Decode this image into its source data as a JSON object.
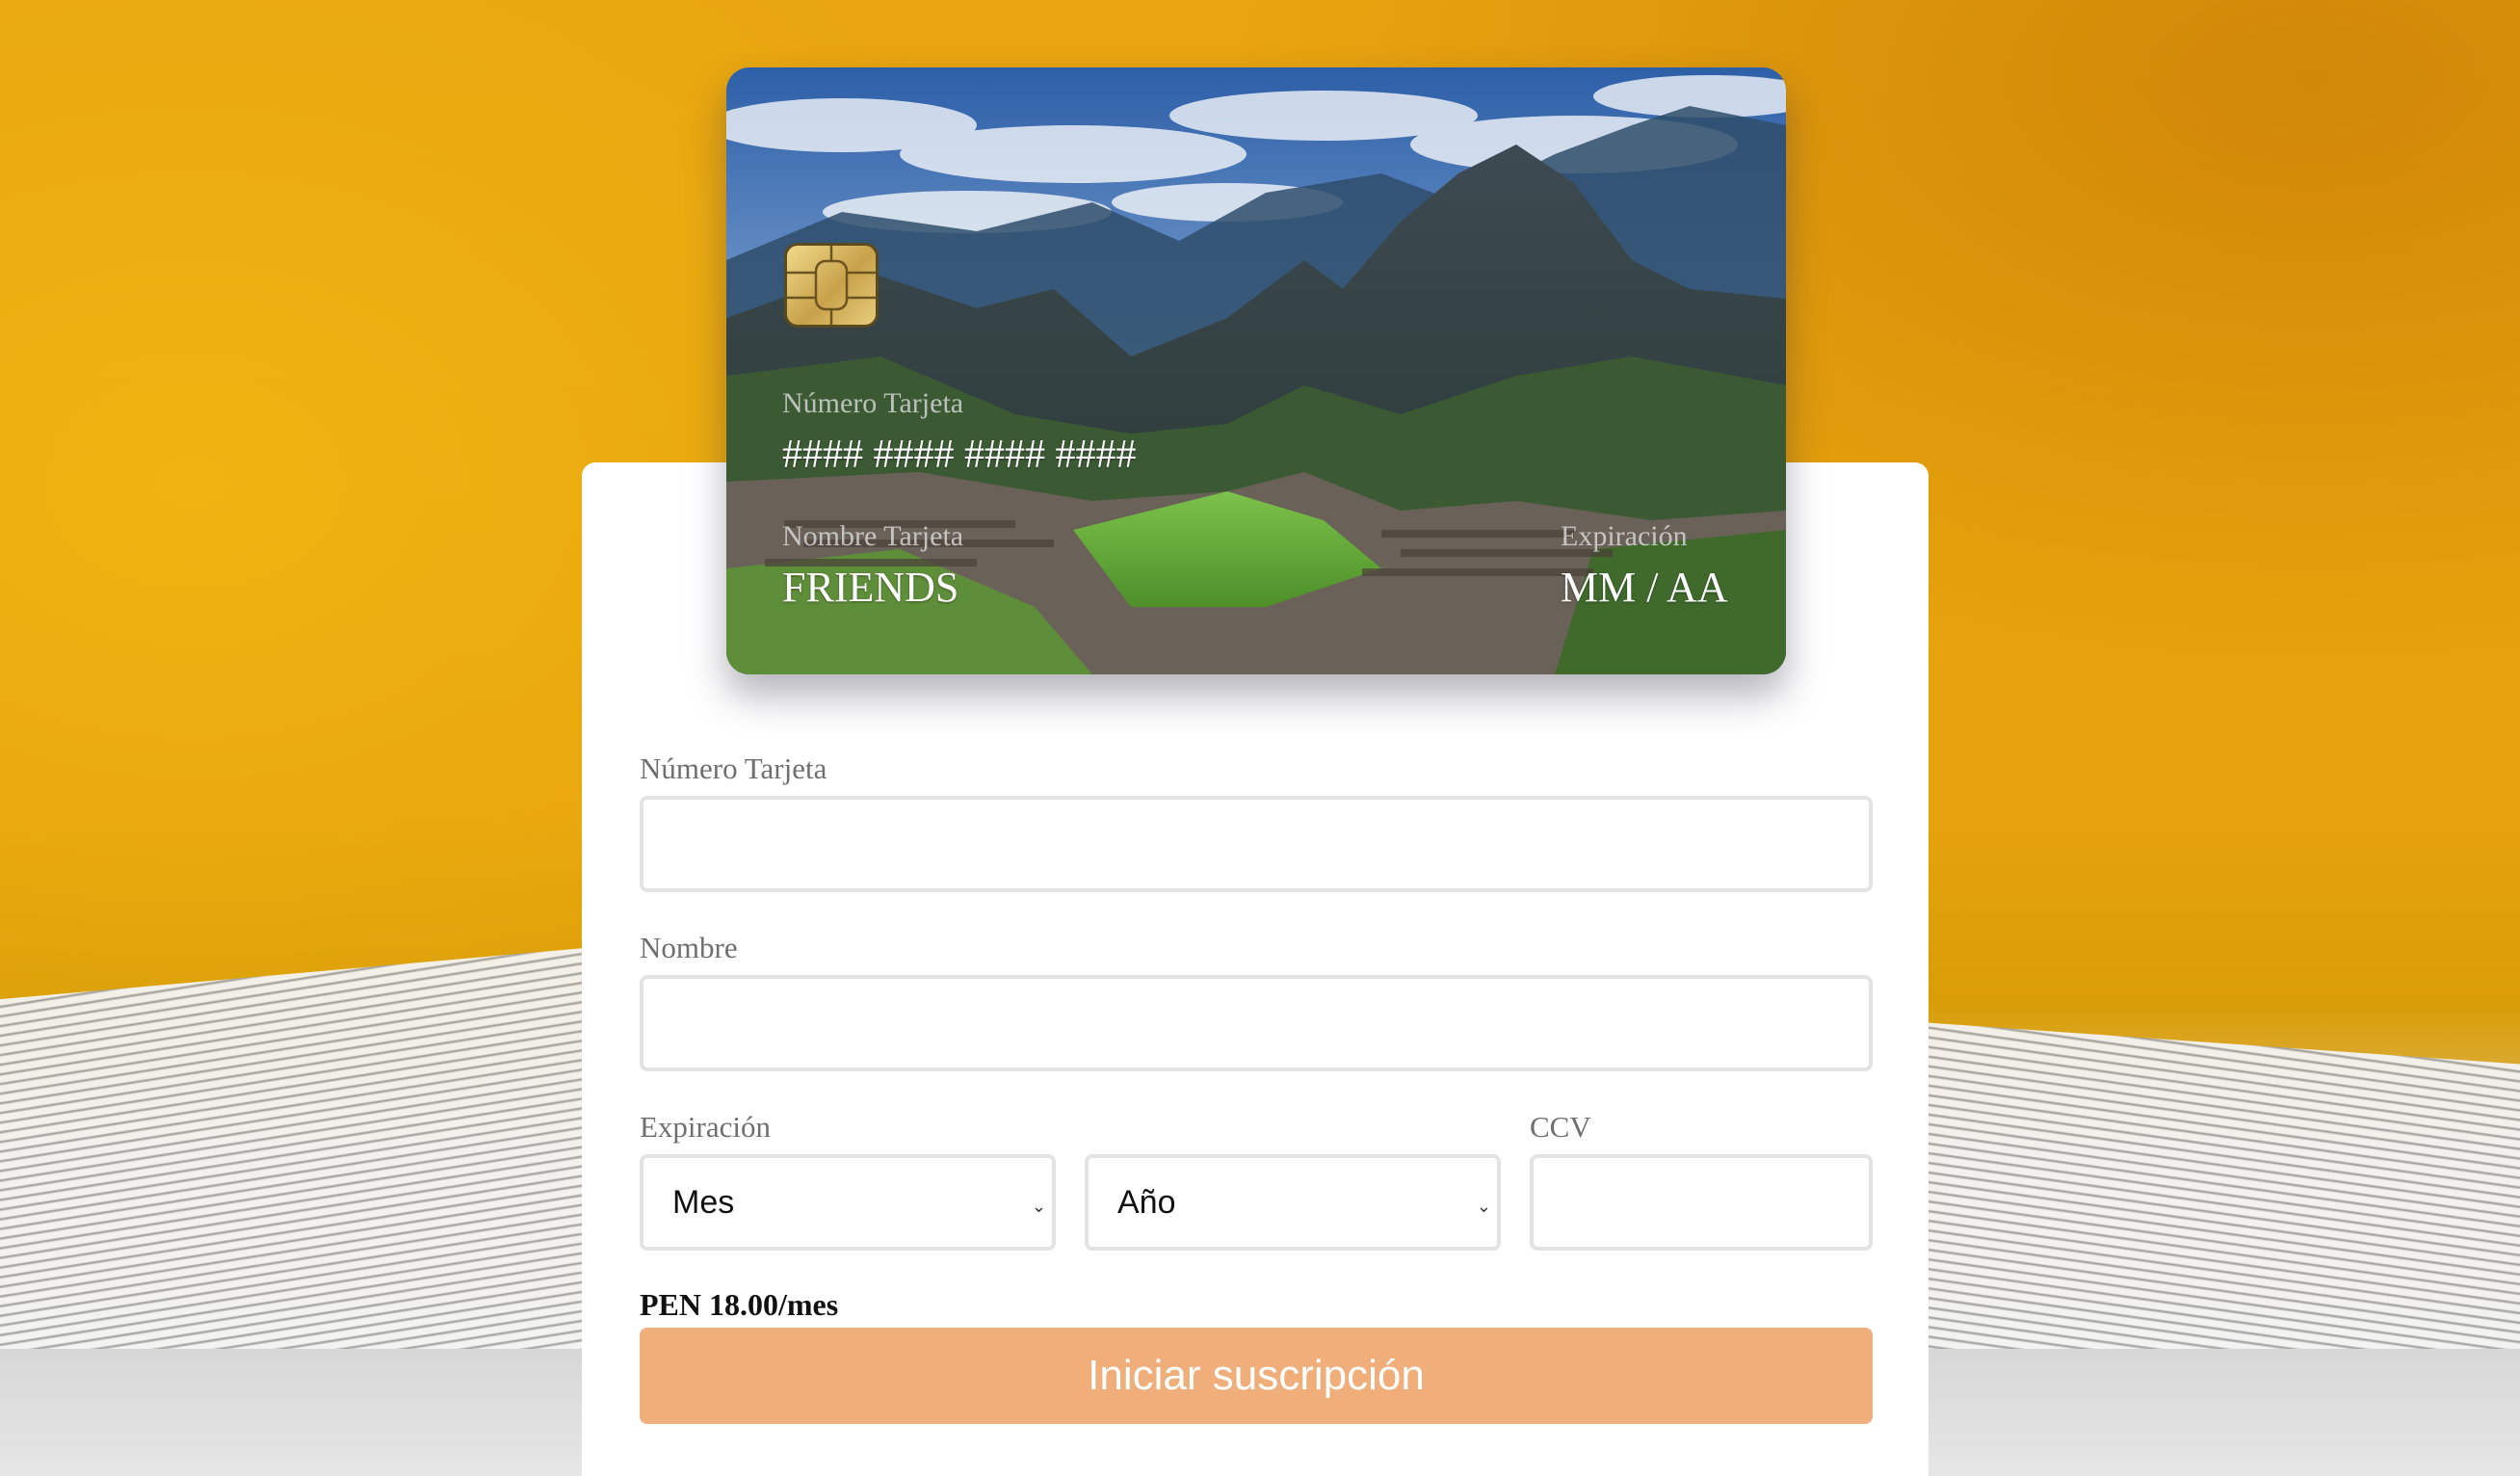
{
  "card": {
    "number_label": "Número Tarjeta",
    "number_placeholder": "#### #### #### ####",
    "name_label": "Nombre Tarjeta",
    "name_value": "FRIENDS",
    "expiry_label": "Expiración",
    "expiry_value": "MM / AA",
    "chip_icon": "chip-icon",
    "background_image": "mountain-ruins-landscape"
  },
  "form": {
    "number_label": "Número Tarjeta",
    "number_value": "",
    "name_label": "Nombre",
    "name_value": "",
    "expiry_label": "Expiración",
    "month_selected": "Mes",
    "year_selected": "Año",
    "ccv_label": "CCV",
    "ccv_value": ""
  },
  "price": "PEN 18.00/mes",
  "submit_label": "Iniciar suscripción",
  "colors": {
    "background": "#e8a510",
    "button": "#efae7a",
    "input_border": "#e3e3e3"
  }
}
